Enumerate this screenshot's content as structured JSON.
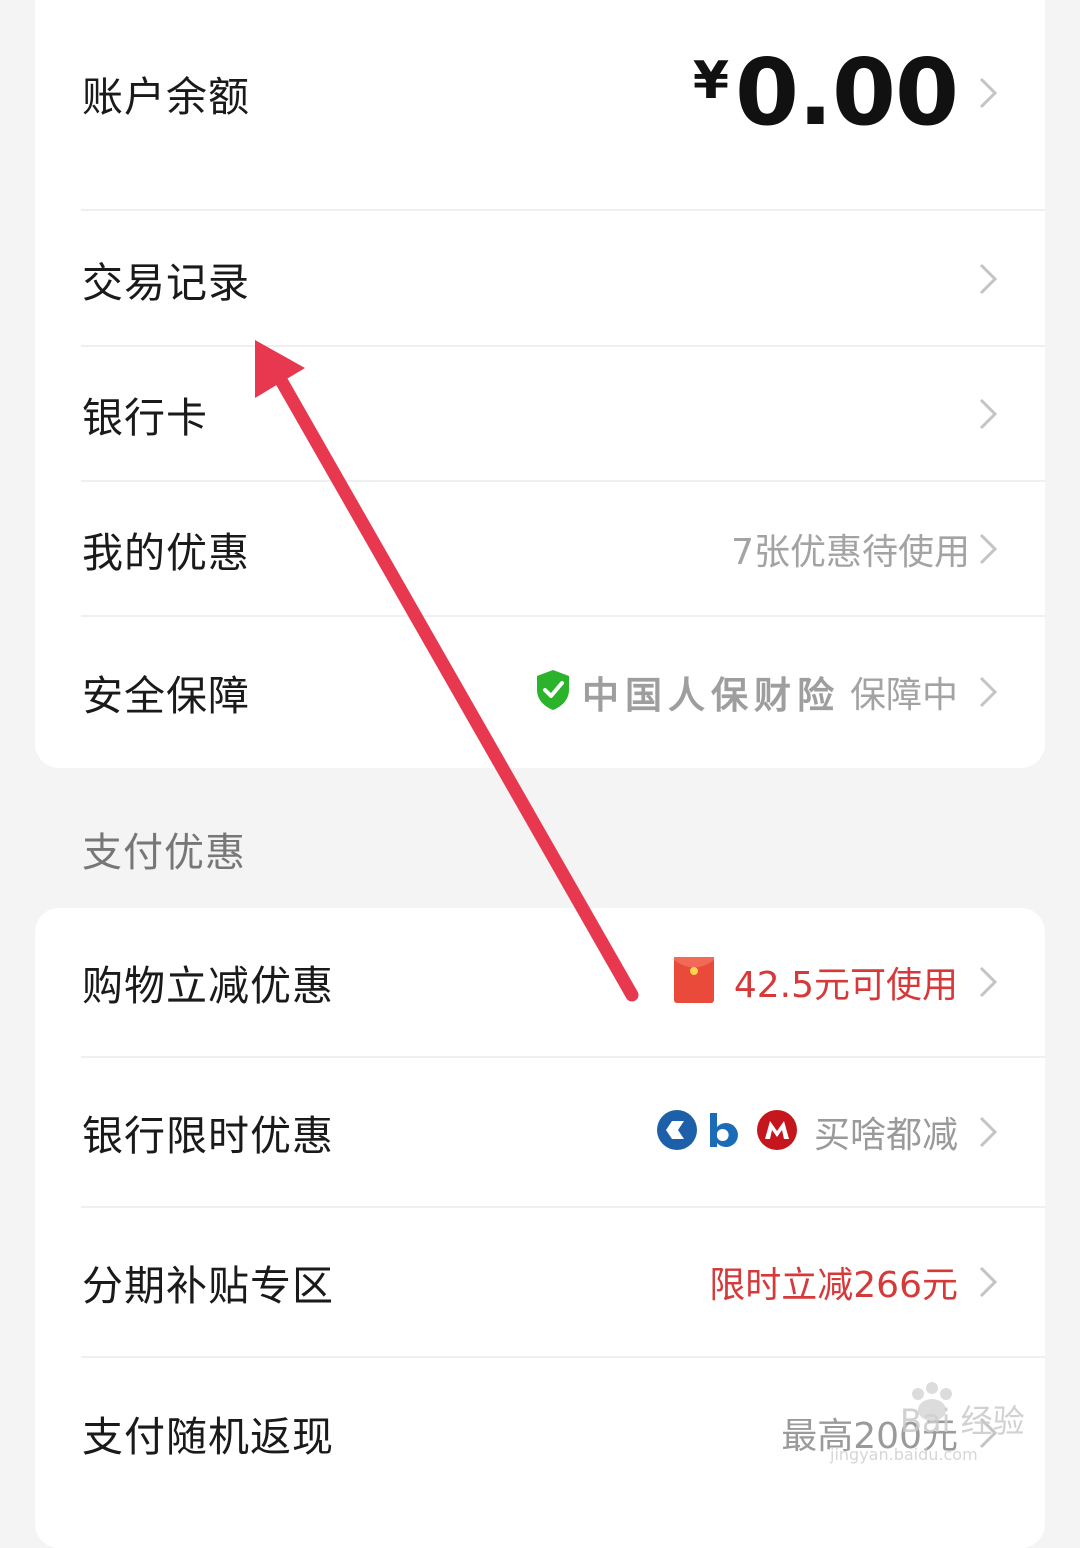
{
  "account": {
    "balance_label": "账户余额",
    "currency_symbol": "¥",
    "balance_amount": "0.00",
    "transactions_label": "交易记录",
    "bank_card_label": "银行卡",
    "my_coupons_label": "我的优惠",
    "my_coupons_value": "7张优惠待使用",
    "security_label": "安全保障",
    "security_insurer": "中国人保财险",
    "security_status": "保障中"
  },
  "promo": {
    "section_title": "支付优惠",
    "shopping_discount_label": "购物立减优惠",
    "shopping_discount_value": "42.5元可使用",
    "bank_limited_label": "银行限时优惠",
    "bank_limited_value": "买啥都减",
    "installment_label": "分期补贴专区",
    "installment_value": "限时立减266元",
    "cashback_label": "支付随机返现",
    "cashback_value": "最高200元"
  },
  "watermark": {
    "brand": "Bai 经验",
    "url": "jingyan.baidu.com"
  },
  "colors": {
    "accent_red": "#d6393a",
    "arrow_red": "#e8384f",
    "shield_green": "#2bb32b",
    "icbc_blue": "#1d5fa8",
    "cmb_red": "#c4161c"
  },
  "icons": [
    "chevron-right-icon",
    "shield-check-icon",
    "red-envelope-icon",
    "bank-logo-icon"
  ]
}
